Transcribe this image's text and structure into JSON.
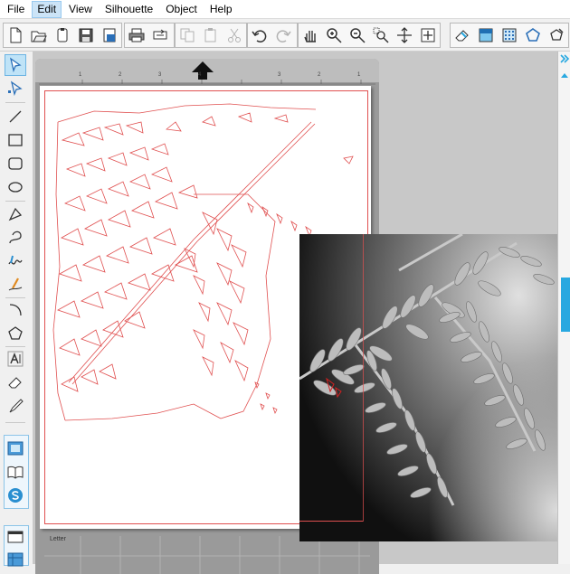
{
  "menu": {
    "file": "File",
    "edit": "Edit",
    "view": "View",
    "silhouette": "Silhouette",
    "object": "Object",
    "help": "Help"
  },
  "toolbar": {
    "groups": [
      [
        "new-document-icon",
        "open-folder-icon",
        "open-template-icon",
        "save-icon",
        "save-library-icon"
      ],
      [
        "print-icon",
        "send-to-cutter-icon"
      ],
      [
        "copy-icon",
        "paste-icon",
        "cut-icon"
      ],
      [
        "undo-icon",
        "redo-icon"
      ],
      [
        "pan-hand-icon",
        "zoom-in-icon",
        "zoom-out-icon",
        "zoom-select-icon",
        "zoom-fit-icon",
        "fit-page-icon"
      ],
      [
        "eraser-icon",
        "fill-color-icon",
        "fill-pattern-icon",
        "line-color-icon",
        "line-style-icon"
      ]
    ]
  },
  "canvas": {
    "mat_label": "Letter",
    "ruler_numbers": [
      "1",
      "2",
      "3",
      "4",
      "3",
      "2",
      "1"
    ]
  },
  "colors": {
    "accent": "#28a8e0",
    "cut_line": "#e05050",
    "selected_tool_bg": "#bfe3f7"
  }
}
